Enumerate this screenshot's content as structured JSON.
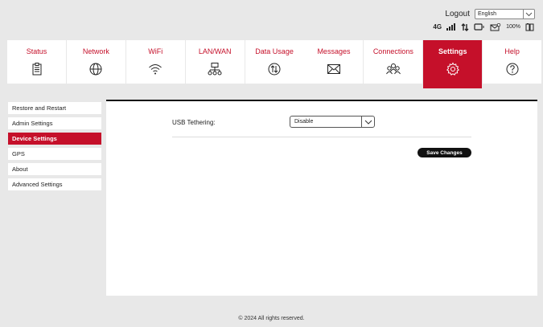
{
  "header": {
    "logout_label": "Logout",
    "language": {
      "selected": "English"
    },
    "status": {
      "network": "4G",
      "signal_icon": "signal-bars-icon",
      "data_icon": "data-arrows-icon",
      "battery_text": "100%"
    }
  },
  "nav": [
    {
      "label": "Status",
      "icon": "clipboard-icon"
    },
    {
      "label": "Network",
      "icon": "globe-icon"
    },
    {
      "label": "WiFi",
      "icon": "wifi-icon"
    },
    {
      "label": "LAN/WAN",
      "icon": "lan-icon"
    },
    {
      "label": "Data Usage",
      "icon": "data-usage-icon"
    },
    {
      "label": "Messages",
      "icon": "envelope-icon"
    },
    {
      "label": "Connections",
      "icon": "users-icon"
    },
    {
      "label": "Settings",
      "icon": "gear-icon",
      "active": true
    },
    {
      "label": "Help",
      "icon": "question-icon"
    }
  ],
  "sidebar": [
    {
      "label": "Restore and Restart"
    },
    {
      "label": "Admin Settings"
    },
    {
      "label": "Device Settings",
      "active": true
    },
    {
      "label": "GPS"
    },
    {
      "label": "About"
    },
    {
      "label": "Advanced Settings"
    }
  ],
  "main": {
    "usb_label": "USB Tethering:",
    "usb_value": "Disable",
    "save_label": "Save Changes"
  },
  "footer": {
    "text": "© 2024 All rights reserved."
  },
  "colors": {
    "accent": "#c5102a",
    "background": "#e8e8e8"
  }
}
